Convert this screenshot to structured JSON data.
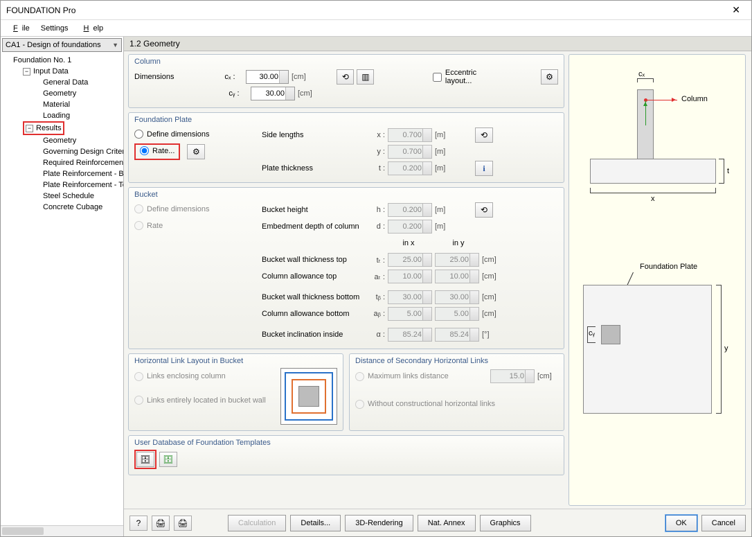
{
  "title": "FOUNDATION Pro",
  "menu": {
    "file": "File",
    "settings": "Settings",
    "help": "Help"
  },
  "combo": "CA1 - Design of foundations",
  "tree": {
    "root": "Foundation No. 1",
    "input": "Input Data",
    "inputItems": [
      "General Data",
      "Geometry",
      "Material",
      "Loading"
    ],
    "results": "Results",
    "resultsItems": [
      "Geometry",
      "Governing Design Criteria",
      "Required Reinforcement",
      "Plate Reinforcement - Bottom",
      "Plate Reinforcement - Top",
      "Steel Schedule",
      "Concrete Cubage"
    ]
  },
  "header": "1.2 Geometry",
  "column": {
    "legend": "Column",
    "dimLabel": "Dimensions",
    "cx": "cₓ :",
    "cxVal": "30.00",
    "cxUnit": "[cm]",
    "cy": "cᵧ :",
    "cyVal": "30.00",
    "cyUnit": "[cm]",
    "ecc": "Eccentric layout..."
  },
  "plate": {
    "legend": "Foundation Plate",
    "opt1": "Define dimensions",
    "opt2": "Rate...",
    "sideLen": "Side lengths",
    "thick": "Plate thickness",
    "x": "x :",
    "xVal": "0.700",
    "xUnit": "[m]",
    "y": "y :",
    "yVal": "0.700",
    "yUnit": "[m]",
    "t": "t :",
    "tVal": "0.200",
    "tUnit": "[m]"
  },
  "bucket": {
    "legend": "Bucket",
    "opt1": "Define dimensions",
    "opt2": "Rate",
    "height": "Bucket height",
    "h": "h :",
    "hVal": "0.200",
    "hUnit": "[m]",
    "embed": "Embedment depth of column",
    "d": "d :",
    "dVal": "0.200",
    "dUnit": "[m]",
    "inx": "in x",
    "iny": "in y",
    "topThk": "Bucket wall thickness top",
    "tt": "tₜ :",
    "ttx": "25.00",
    "tty": "25.00",
    "ttUnit": "[cm]",
    "colAllowTop": "Column allowance top",
    "at": "aₜ :",
    "atx": "10.00",
    "aty": "10.00",
    "atUnit": "[cm]",
    "botThk": "Bucket wall thickness bottom",
    "tb": "tᵦ :",
    "tbx": "30.00",
    "tby": "30.00",
    "tbUnit": "[cm]",
    "colAllowBot": "Column allowance bottom",
    "ab": "aᵦ :",
    "abx": "5.00",
    "aby": "5.00",
    "abUnit": "[cm]",
    "incl": "Bucket inclination inside",
    "al": "α :",
    "alx": "85.24",
    "aly": "85.24",
    "alUnit": "[°]"
  },
  "links": {
    "legend": "Horizontal Link Layout in Bucket",
    "o1": "Links enclosing column",
    "o2": "Links entirely located in bucket wall"
  },
  "dist": {
    "legend": "Distance of Secondary Horizontal Links",
    "o1": "Maximum links distance",
    "v": "15.0",
    "u": "[cm]",
    "o2": "Without constructional horizontal links"
  },
  "udb": {
    "legend": "User Database of Foundation Templates"
  },
  "diag": {
    "cx": "cₓ",
    "column": "Column",
    "t": "t",
    "x": "x",
    "y": "y",
    "cy": "cᵧ",
    "plate": "Foundation Plate"
  },
  "footer": {
    "calc": "Calculation",
    "details": "Details...",
    "render": "3D-Rendering",
    "annex": "Nat. Annex",
    "graphics": "Graphics",
    "ok": "OK",
    "cancel": "Cancel"
  }
}
